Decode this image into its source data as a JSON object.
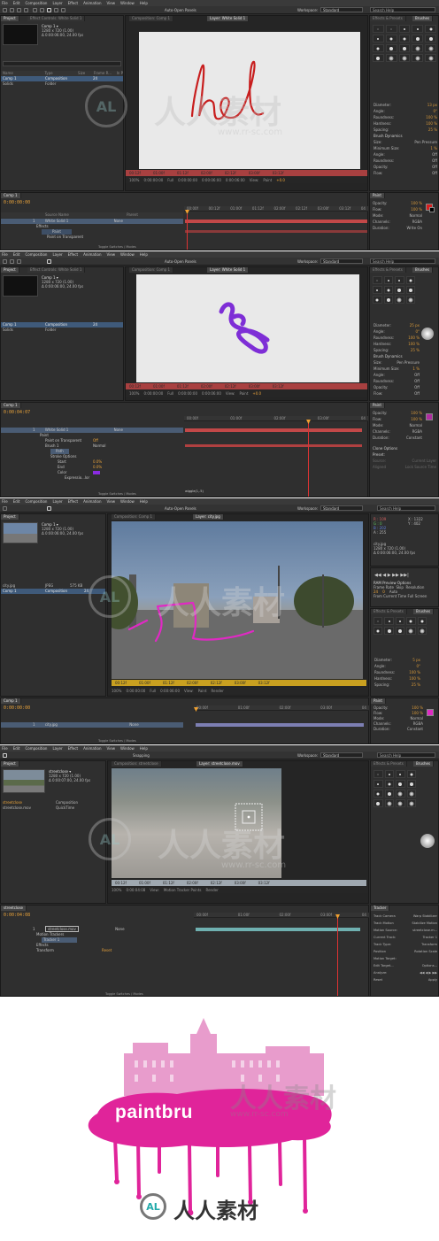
{
  "menu": [
    "File",
    "Edit",
    "Composition",
    "Layer",
    "Effect",
    "Animation",
    "View",
    "Window",
    "Help"
  ],
  "toolbar": {
    "auto_open": "Auto-Open Panels",
    "workspace_label": "Workspace:",
    "workspace": "Standard",
    "search": "Search Help",
    "snapping": "Snapping"
  },
  "watermark": {
    "brand": "人人素材",
    "url": "www.rr-sc.com",
    "logo_letters": "AL"
  },
  "screen1": {
    "tabs": {
      "project": "Project",
      "effect_controls": "Effect Controls: White Solid 1",
      "composition": "Composition: Comp 1",
      "layer": "Layer: White Solid 1",
      "effects_presets": "Effects & Presets",
      "brushes": "Brushes"
    },
    "project_meta": [
      "Comp 1 ▾",
      "1280 x 720 (1.00)",
      "Δ 0:00:06:00, 24.00 fps"
    ],
    "project_cols": [
      "Name",
      "Type",
      "Size",
      "Frame R...",
      "In P"
    ],
    "project_rows": [
      {
        "name": "Comp 1",
        "type": "Composition",
        "rate": "24"
      },
      {
        "name": "Solids",
        "type": "Folder",
        "rate": ""
      }
    ],
    "viewer_text": "hel",
    "tl_ticks": [
      "00:12f",
      "01:00f",
      "01:12f",
      "02:00f",
      "02:12f",
      "03:00f",
      "03:12f"
    ],
    "ctrl": [
      "100%",
      "0:00:00:00",
      "Full",
      "0:00:00:00",
      "0:00:06:00",
      "0:00:06:00",
      "View:",
      "Paint",
      "+0.0"
    ],
    "timecode": "0:00:00:00",
    "comp_tab": "Comp 1",
    "layers": [
      {
        "num": "1",
        "name": "White Solid 1"
      },
      {
        "num": "",
        "name": "Effects"
      },
      {
        "num": "",
        "name": "Paint"
      },
      {
        "num": "",
        "name": "Paint on Transparent"
      }
    ],
    "cols": [
      "Source Name",
      "Parent"
    ],
    "parent_val": "None",
    "ruler": [
      "00:00f",
      "00:12f",
      "01:00f",
      "01:12f",
      "02:00f",
      "02:12f",
      "03:00f",
      "03:12f",
      "04"
    ],
    "toggle": "Toggle Switches / Modes",
    "brush": [
      {
        "k": "Diameter:",
        "v": "13 px"
      },
      {
        "k": "Angle:",
        "v": "0°"
      },
      {
        "k": "Roundness:",
        "v": "100 %"
      },
      {
        "k": "Hardness:",
        "v": "100 %"
      },
      {
        "k": "Spacing:",
        "v": "25 %"
      },
      {
        "k": "Brush Dynamics",
        "v": ""
      },
      {
        "k": "Size:",
        "v": "Pen Pressure"
      },
      {
        "k": "Minimum Size:",
        "v": "1 %"
      },
      {
        "k": "Angle:",
        "v": "Off"
      },
      {
        "k": "Roundness:",
        "v": "Off"
      },
      {
        "k": "Opacity:",
        "v": "Off"
      },
      {
        "k": "Flow:",
        "v": "Off"
      }
    ],
    "paint_tab": "Paint",
    "paint": [
      {
        "k": "Opacity:",
        "v": "100 %"
      },
      {
        "k": "Flow:",
        "v": "100 %"
      },
      {
        "k": "Mode:",
        "v": "Normal"
      },
      {
        "k": "Channels:",
        "v": "RGBA"
      },
      {
        "k": "Duration:",
        "v": "Write On"
      }
    ]
  },
  "screen2": {
    "project_meta": [
      "Comp 1 ▾",
      "1280 x 720 (1.00)",
      "Δ 0:00:06:00, 24.00 fps"
    ],
    "project_rows": [
      {
        "name": "Comp 1",
        "type": "Composition",
        "rate": "24"
      },
      {
        "name": "Solids",
        "type": "Folder",
        "rate": ""
      }
    ],
    "timecode": "0:00:04:07",
    "layers": [
      {
        "num": "1",
        "name": "White Solid 1"
      },
      {
        "num": "",
        "name": "Paint"
      },
      {
        "num": "",
        "name": "Paint on Transparent"
      },
      {
        "num": "",
        "name": "Brush 1"
      },
      {
        "num": "",
        "name": "Path"
      },
      {
        "num": "",
        "name": "Stroke Options"
      },
      {
        "num": "",
        "name": "Start"
      },
      {
        "num": "",
        "name": "End"
      },
      {
        "num": "",
        "name": "Color"
      },
      {
        "num": "",
        "name": "Expressio...lor"
      }
    ],
    "values": [
      "Off",
      "Normal",
      "0.0%",
      "0.0%"
    ],
    "expr": "wiggle(1,.5)",
    "brush": [
      {
        "k": "Diameter:",
        "v": "25 px"
      },
      {
        "k": "Angle:",
        "v": "0°"
      },
      {
        "k": "Roundness:",
        "v": "100 %"
      },
      {
        "k": "Hardness:",
        "v": "100 %"
      },
      {
        "k": "Spacing:",
        "v": "25 %"
      },
      {
        "k": "Brush Dynamics",
        "v": ""
      },
      {
        "k": "Size:",
        "v": "Pen Pressure"
      },
      {
        "k": "Minimum Size:",
        "v": "1 %"
      },
      {
        "k": "Angle:",
        "v": "Off"
      },
      {
        "k": "Roundness:",
        "v": "Off"
      },
      {
        "k": "Opacity:",
        "v": "Off"
      },
      {
        "k": "Flow:",
        "v": "Off"
      }
    ],
    "paint": [
      {
        "k": "Opacity:",
        "v": "100 %"
      },
      {
        "k": "Flow:",
        "v": "100 %"
      },
      {
        "k": "Mode:",
        "v": "Normal"
      },
      {
        "k": "Channels:",
        "v": "RGBA"
      },
      {
        "k": "Duration:",
        "v": "Constant"
      }
    ],
    "extra": [
      "Clone Options",
      "Preset:",
      "Source:",
      "Current Layer",
      "Aligned",
      "Lock Source Time"
    ]
  },
  "screen3": {
    "tabs": {
      "composition": "Composition: Comp 1",
      "layer": "Layer: city.jpg"
    },
    "project_meta": [
      "Comp 1 ▾",
      "1280 x 720 (1.00)",
      "Δ 0:00:06:00, 24.00 fps"
    ],
    "project_rows": [
      {
        "name": "city.jpg",
        "type": "JPEG",
        "size": "575 KB"
      },
      {
        "name": "Comp 1",
        "type": "Composition",
        "size": "24"
      }
    ],
    "info": [
      "R : 109",
      "G : 0",
      "B : 202",
      "A : 255",
      "X : 1322",
      "Y : 402"
    ],
    "info_file": [
      "city.jpg",
      "1280 x 720 (1.00)",
      "Δ 0:00:06:00, 24.00 fps"
    ],
    "ram": [
      "RAM Preview Options",
      "Frame Rate",
      "Skip",
      "Resolution",
      "24",
      "0",
      "Auto",
      "From Current Time",
      "Full Screen"
    ],
    "timecode": "0:00:00:00",
    "layer_name": "city.jpg",
    "brush": [
      {
        "k": "Diameter:",
        "v": "5 px"
      },
      {
        "k": "Angle:",
        "v": "0°"
      },
      {
        "k": "Roundness:",
        "v": "100 %"
      },
      {
        "k": "Hardness:",
        "v": "100 %"
      },
      {
        "k": "Spacing:",
        "v": "25 %"
      }
    ],
    "paint": [
      {
        "k": "Opacity:",
        "v": "100 %"
      },
      {
        "k": "Flow:",
        "v": "100 %"
      },
      {
        "k": "Mode:",
        "v": "Normal"
      },
      {
        "k": "Channels:",
        "v": "RGBA"
      },
      {
        "k": "Duration:",
        "v": "Constant"
      }
    ],
    "render": "Render"
  },
  "screen4": {
    "tabs": {
      "composition": "Composition: streetclose",
      "layer": "Layer: streetclose.mov"
    },
    "project_meta": [
      "streetclose ▾",
      "1280 x 720 (1.00)",
      "Δ 0:00:07:00, 24.00 fps"
    ],
    "project_rows": [
      {
        "name": "streetclose",
        "type": "Composition"
      },
      {
        "name": "streetclose.mov",
        "type": "QuickTime"
      }
    ],
    "timecode": "0:00:04:08",
    "comp_tab": "streetclose",
    "layers": [
      {
        "num": "1",
        "name": "streetclose.mov"
      },
      {
        "num": "",
        "name": "Motion Trackers"
      },
      {
        "num": "",
        "name": "Tracker 1"
      },
      {
        "num": "",
        "name": "Effects"
      },
      {
        "num": "",
        "name": "Transform"
      }
    ],
    "reset": "Reset",
    "tracker_tab": "Tracker",
    "tracker": [
      {
        "k": "Track Camera",
        "v": "Warp Stabilizer"
      },
      {
        "k": "Track Motion",
        "v": "Stabilize Motion"
      },
      {
        "k": "Motion Source:",
        "v": "streetclose.m..."
      },
      {
        "k": "Current Track:",
        "v": "Tracker 1"
      },
      {
        "k": "Track Type:",
        "v": "Transform"
      },
      {
        "k": "Position",
        "v": "Rotation  Scale"
      },
      {
        "k": "Motion Target:",
        "v": ""
      },
      {
        "k": "Edit Target...",
        "v": "Options..."
      },
      {
        "k": "Analyze:",
        "v": "◀◀ ◀ ▶ ▶▶"
      },
      {
        "k": "Reset",
        "v": "Apply"
      }
    ],
    "tracker_label": "Motion Tracker Points"
  },
  "poster": {
    "title": "paintbru"
  },
  "colors": {
    "accent": "#e8a23a",
    "paint_red": "#c81e1e",
    "paint_purple": "#8a2be2",
    "paint_magenta": "#e0249a",
    "ui_bg": "#2b2b2b"
  }
}
